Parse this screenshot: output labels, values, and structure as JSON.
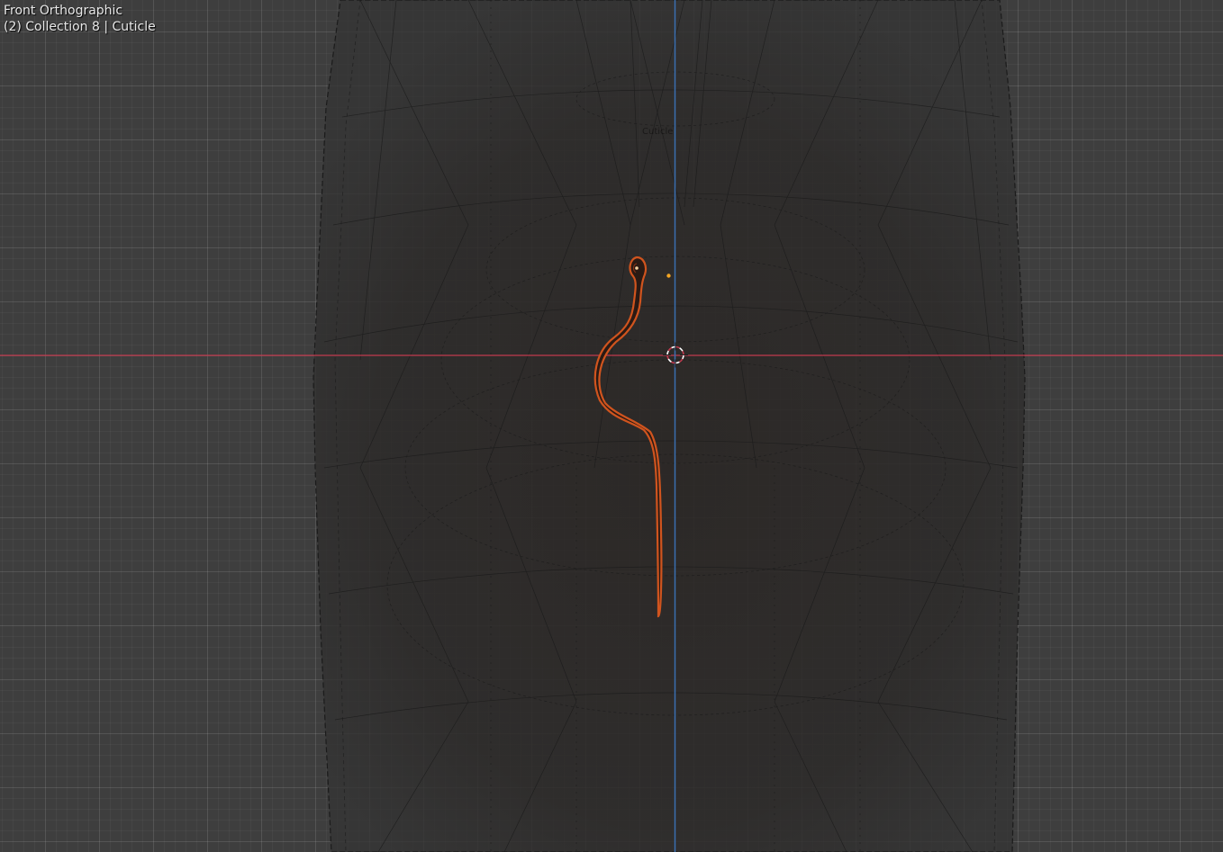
{
  "viewport": {
    "view_name": "Front Orthographic",
    "collection_info": "(2) Collection 8 | Cuticle",
    "ghost_label": "Cuticle"
  },
  "colors": {
    "background": "#3e3e3e",
    "x_axis": "#c0394d",
    "z_axis": "#3a6fb0",
    "selected_curve": "#d0541e",
    "selected_curve_inner": "#8a3214",
    "origin_dot": "#f5a623",
    "cursor_outer": "#ffffff",
    "cursor_inner": "#c0394d",
    "wire": "#1a1a1a"
  },
  "icons": {
    "cursor": "3d-cursor-icon",
    "origin": "object-origin-icon"
  }
}
